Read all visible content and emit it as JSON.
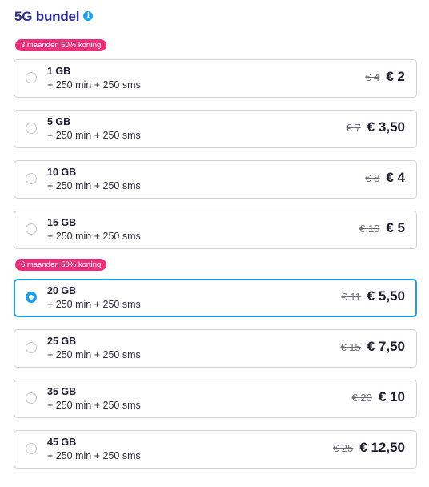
{
  "header": {
    "title": "5G bundel",
    "info_icon": "i"
  },
  "groups": [
    {
      "badge": "3 maanden 50% korting",
      "options": [
        {
          "gb": "1 GB",
          "extras": "+ 250 min + 250 sms",
          "old_price": "€ 4",
          "new_price": "€ 2",
          "selected": false
        },
        {
          "gb": "5 GB",
          "extras": "+ 250 min + 250 sms",
          "old_price": "€ 7",
          "new_price": "€ 3,50",
          "selected": false
        },
        {
          "gb": "10 GB",
          "extras": "+ 250 min + 250 sms",
          "old_price": "€ 8",
          "new_price": "€ 4",
          "selected": false
        },
        {
          "gb": "15 GB",
          "extras": "+ 250 min + 250 sms",
          "old_price": "€ 10",
          "new_price": "€ 5",
          "selected": false
        }
      ]
    },
    {
      "badge": "6 maanden 50% korting",
      "options": [
        {
          "gb": "20 GB",
          "extras": "+ 250 min + 250 sms",
          "old_price": "€ 11",
          "new_price": "€ 5,50",
          "selected": true
        },
        {
          "gb": "25 GB",
          "extras": "+ 250 min + 250 sms",
          "old_price": "€ 15",
          "new_price": "€ 7,50",
          "selected": false
        },
        {
          "gb": "35 GB",
          "extras": "+ 250 min + 250 sms",
          "old_price": "€ 20",
          "new_price": "€ 10",
          "selected": false
        },
        {
          "gb": "45 GB",
          "extras": "+ 250 min + 250 sms",
          "old_price": "€ 25",
          "new_price": "€ 12,50",
          "selected": false
        }
      ]
    }
  ],
  "colors": {
    "title": "#2a2d8f",
    "accent": "#1ea0e6",
    "badge": "#e8317a",
    "border": "#cfd2d8"
  }
}
